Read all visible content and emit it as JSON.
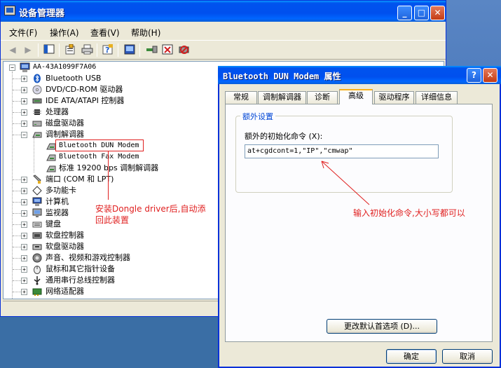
{
  "window": {
    "title": "设备管理器",
    "menu": [
      "文件(F)",
      "操作(A)",
      "查看(V)",
      "帮助(H)"
    ],
    "toolbar_icons": [
      "back-icon",
      "forward-icon",
      "show-hide-tree-icon",
      "properties-icon",
      "print-icon",
      "help-icon",
      "console-icon",
      "scan-hardware-icon",
      "uninstall-icon",
      "disable-icon"
    ]
  },
  "tree": {
    "root": "AA-43A1099F7A06",
    "items": [
      {
        "label": "Bluetooth USB",
        "icon": "bluetooth-icon"
      },
      {
        "label": "DVD/CD-ROM 驱动器",
        "icon": "cdrom-icon"
      },
      {
        "label": "IDE ATA/ATAPI 控制器",
        "icon": "ide-icon"
      },
      {
        "label": "处理器",
        "icon": "cpu-icon"
      },
      {
        "label": "磁盘驱动器",
        "icon": "disk-icon"
      },
      {
        "label": "调制解调器",
        "icon": "modem-icon"
      },
      {
        "label": "端口 (COM 和 LPT)",
        "icon": "port-icon"
      },
      {
        "label": "多功能卡",
        "icon": "multifunction-icon"
      },
      {
        "label": "计算机",
        "icon": "computer-icon"
      },
      {
        "label": "监视器",
        "icon": "monitor-icon"
      },
      {
        "label": "键盘",
        "icon": "keyboard-icon"
      },
      {
        "label": "软盘控制器",
        "icon": "floppy-controller-icon"
      },
      {
        "label": "软盘驱动器",
        "icon": "floppy-drive-icon"
      },
      {
        "label": "声音、视频和游戏控制器",
        "icon": "sound-icon"
      },
      {
        "label": "鼠标和其它指针设备",
        "icon": "mouse-icon"
      },
      {
        "label": "通用串行总线控制器",
        "icon": "usb-icon"
      },
      {
        "label": "网络适配器",
        "icon": "network-icon"
      }
    ],
    "modem_children": [
      "Bluetooth DUN Modem",
      "Bluetooth Fax Modem",
      "标准 19200 bps 调制解调器"
    ]
  },
  "annotations": {
    "left": "安装Dongle driver后,自动添回此装置",
    "right": "输入初始化命令,大小写都可以"
  },
  "dialog": {
    "title": "Bluetooth DUN Modem 属性",
    "tabs": [
      "常规",
      "调制解调器",
      "诊断",
      "高级",
      "驱动程序",
      "详细信息"
    ],
    "active_tab": "高级",
    "group_label": "额外设置",
    "field_label": "额外的初始化命令 (X):",
    "field_value": "at+cgdcont=1,\"IP\",\"cmwap\"",
    "change_defaults_button": "更改默认首选项 (D)...",
    "ok": "确定",
    "cancel": "取消"
  },
  "colors": {
    "titlebar": "#0053ee",
    "annotation": "#e02020",
    "desktop": "#3a6ea5"
  }
}
